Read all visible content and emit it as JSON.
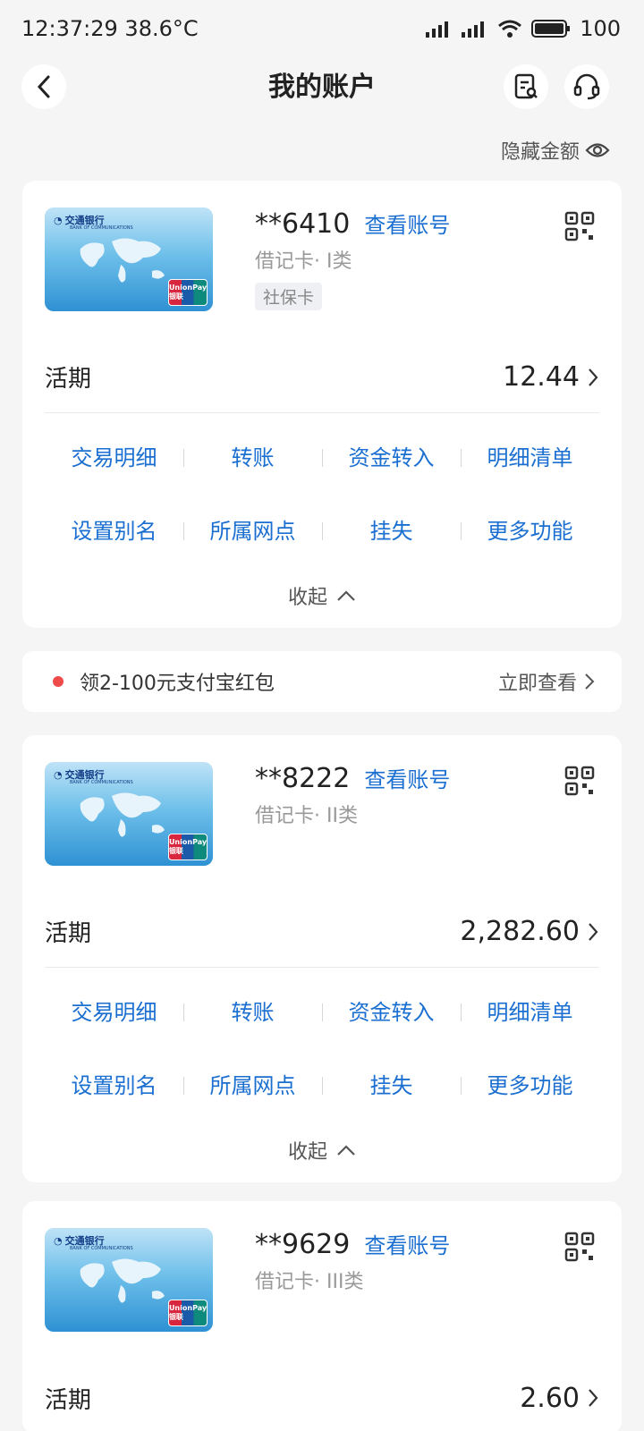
{
  "status_bar": {
    "time_temp": "12:37:29 38.6°C",
    "battery": "100"
  },
  "header": {
    "title": "我的账户"
  },
  "hide_amount": {
    "label": "隐藏金额"
  },
  "accounts": [
    {
      "card_number": "**6410",
      "view_account": "查看账号",
      "card_type": "借记卡· I类",
      "tag": "社保卡",
      "balance_label": "活期",
      "balance": "12.44",
      "actions_row1": [
        "交易明细",
        "转账",
        "资金转入",
        "明细清单"
      ],
      "actions_row2": [
        "设置别名",
        "所属网点",
        "挂失",
        "更多功能"
      ],
      "collapse": "收起"
    },
    {
      "card_number": "**8222",
      "view_account": "查看账号",
      "card_type": "借记卡· II类",
      "balance_label": "活期",
      "balance": "2,282.60",
      "actions_row1": [
        "交易明细",
        "转账",
        "资金转入",
        "明细清单"
      ],
      "actions_row2": [
        "设置别名",
        "所属网点",
        "挂失",
        "更多功能"
      ],
      "collapse": "收起"
    },
    {
      "card_number": "**9629",
      "view_account": "查看账号",
      "card_type": "借记卡· III类",
      "balance_label": "活期",
      "balance": "2.60"
    }
  ],
  "promo": {
    "text": "领2-100元支付宝红包",
    "action": "立即查看"
  },
  "card_face": {
    "bank_name": "交通银行",
    "bank_en": "BANK OF COMMUNICATIONS",
    "network": "UnionPay 银联"
  },
  "colors": {
    "accent": "#1b6fd1",
    "background": "#f5f5f5",
    "promo_dot": "#ef4b4b"
  }
}
